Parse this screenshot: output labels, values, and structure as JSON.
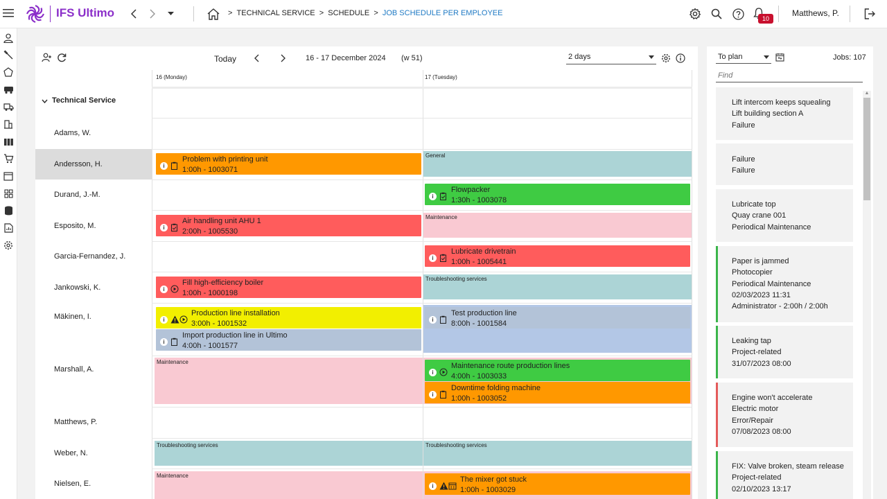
{
  "header": {
    "brand": "IFS Ultimo",
    "breadcrumb": [
      "TECHNICAL SERVICE",
      "SCHEDULE",
      "JOB SCHEDULE PER EMPLOYEE"
    ],
    "notifications_count": "10",
    "user_name": "Matthews, P."
  },
  "toolbar": {
    "today_label": "Today",
    "date_range": "16 - 17 December 2024",
    "week": "(w 51)",
    "view_select": "2 days"
  },
  "days": [
    "16 (Monday)",
    "17 (Tuesday)"
  ],
  "group_label": "Technical Service",
  "resources": [
    "Adams, W.",
    "Andersson, H.",
    "Durand, J.-M.",
    "Esposito, M.",
    "Garcia-Fernandez, J.",
    "Jankowski, K.",
    "Mäkinen, I.",
    "Marshall, A.",
    "Matthews, P.",
    "Weber, N.",
    "Nielsen, E."
  ],
  "bands": {
    "general": "General",
    "maintenance": "Maintenance",
    "troubleshooting": "Troubleshooting services"
  },
  "jobs": {
    "andersson_mon": {
      "title": "Problem with printing unit",
      "detail": "1:00h - 1003071",
      "color": "#ff9800"
    },
    "durand_tue": {
      "title": "Flowpacker",
      "detail": "1:30h - 1003078",
      "color": "#3fcb43"
    },
    "esposito_mon": {
      "title": "Air handling unit AHU 1",
      "detail": "2:00h - 1005530",
      "color": "#ff5c5c"
    },
    "garcia_tue": {
      "title": "Lubricate drivetrain",
      "detail": "1:00h - 1005441",
      "color": "#ff5c5c"
    },
    "jankowski_mon": {
      "title": "Fill high-efficiency boiler",
      "detail": "1:00h - 1000198",
      "color": "#ff5c5c"
    },
    "makinen_mon1": {
      "title": "Production line installation",
      "detail": "3:00h - 1001532",
      "color": "#f2ef00"
    },
    "makinen_mon2": {
      "title": "Import production line in Ultimo",
      "detail": "4:00h - 1001577",
      "color": "#b3c3d8"
    },
    "makinen_tue": {
      "title": "Test production line",
      "detail": "8:00h - 1001584",
      "color": "#b3c3d8"
    },
    "marshall_tue1": {
      "title": "Maintenance route production lines",
      "detail": "4:00h - 1003033",
      "color": "#3fcb43"
    },
    "marshall_tue2": {
      "title": "Downtime folding machine",
      "detail": "1:00h - 1003052",
      "color": "#ff9800"
    },
    "nielsen_tue": {
      "title": "The mixer got stuck",
      "detail": "1:00h - 1003029",
      "color": "#ff9800"
    }
  },
  "backlog": {
    "filter": "To plan",
    "jobs_count": "Jobs: 107",
    "find_placeholder": "Find",
    "cards": [
      {
        "lines": [
          "Lift intercom keeps squealing",
          "Lift building section A",
          "Failure"
        ]
      },
      {
        "lines": [
          "Failure",
          "Failure"
        ]
      },
      {
        "lines": [
          "Lubricate top",
          "Quay crane 001",
          "Periodical Maintenance"
        ]
      },
      {
        "lines": [
          "Paper is jammed",
          "Photocopier",
          "Periodical Maintenance",
          "02/03/2023 11:31",
          "Administrator - 2:00h / 2:00h"
        ],
        "status_color": "#3ab54a"
      },
      {
        "lines": [
          "Leaking tap",
          "Project-related",
          "31/07/2023 08:00"
        ],
        "status_color": "#3ab54a"
      },
      {
        "lines": [
          "Engine won't accelerate",
          "Electric motor",
          "Error/Repair",
          "07/08/2023 08:00"
        ],
        "status_color": "#e45a5a"
      },
      {
        "lines": [
          "FIX: Valve broken, steam release",
          "Project-related",
          "02/10/2023 13:17"
        ],
        "status_color": "#3ab54a"
      }
    ]
  },
  "colors": {
    "brand_purple": "#8b2fc9",
    "link_blue": "#1f7ac4",
    "band_teal": "#acd4d6",
    "band_pink": "#f9c9d2",
    "badge_red": "#c8102e"
  }
}
